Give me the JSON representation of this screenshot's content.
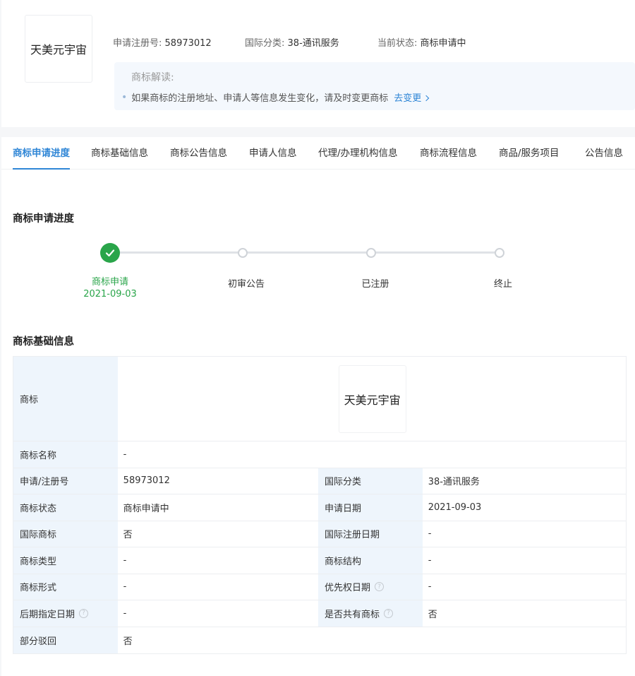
{
  "header": {
    "logo_text": "天美元宇宙",
    "reg_no_label": "申请注册号:",
    "reg_no": "58973012",
    "class_label": "国际分类:",
    "class_value": "38-通讯服务",
    "status_label": "当前状态:",
    "status_value": "商标申请中",
    "interp_title": "商标解读:",
    "interp_tip": "如果商标的注册地址、申请人等信息发生变化，请及时变更商标",
    "interp_link": "去变更"
  },
  "tabs": [
    {
      "label": "商标申请进度"
    },
    {
      "label": "商标基础信息"
    },
    {
      "label": "商标公告信息"
    },
    {
      "label": "申请人信息"
    },
    {
      "label": "代理/办理机构信息"
    },
    {
      "label": "商标流程信息"
    },
    {
      "label": "商品/服务项目"
    },
    {
      "label": "公告信息"
    }
  ],
  "progress": {
    "title": "商标申请进度",
    "steps": [
      {
        "label": "商标申请",
        "date": "2021-09-03"
      },
      {
        "label": "初审公告"
      },
      {
        "label": "已注册"
      },
      {
        "label": "终止"
      }
    ]
  },
  "basic": {
    "title": "商标基础信息",
    "trademark_label": "商标",
    "trademark_img_text": "天美元宇宙",
    "name_label": "商标名称",
    "name_value": "-",
    "rows": [
      {
        "k1": "申请/注册号",
        "v1": "58973012",
        "k2": "国际分类",
        "v2": "38-通讯服务"
      },
      {
        "k1": "商标状态",
        "v1": "商标申请中",
        "k2": "申请日期",
        "v2": "2021-09-03"
      },
      {
        "k1": "国际商标",
        "v1": "否",
        "k2": "国际注册日期",
        "v2": "-"
      },
      {
        "k1": "商标类型",
        "v1": "-",
        "k2": "商标结构",
        "v2": "-"
      },
      {
        "k1": "商标形式",
        "v1": "-",
        "k2": "优先权日期",
        "v2": "-"
      },
      {
        "k1": "后期指定日期",
        "v1": "-",
        "k2": "是否共有商标",
        "v2": "否"
      }
    ],
    "last_label": "部分驳回",
    "last_value": "否"
  }
}
